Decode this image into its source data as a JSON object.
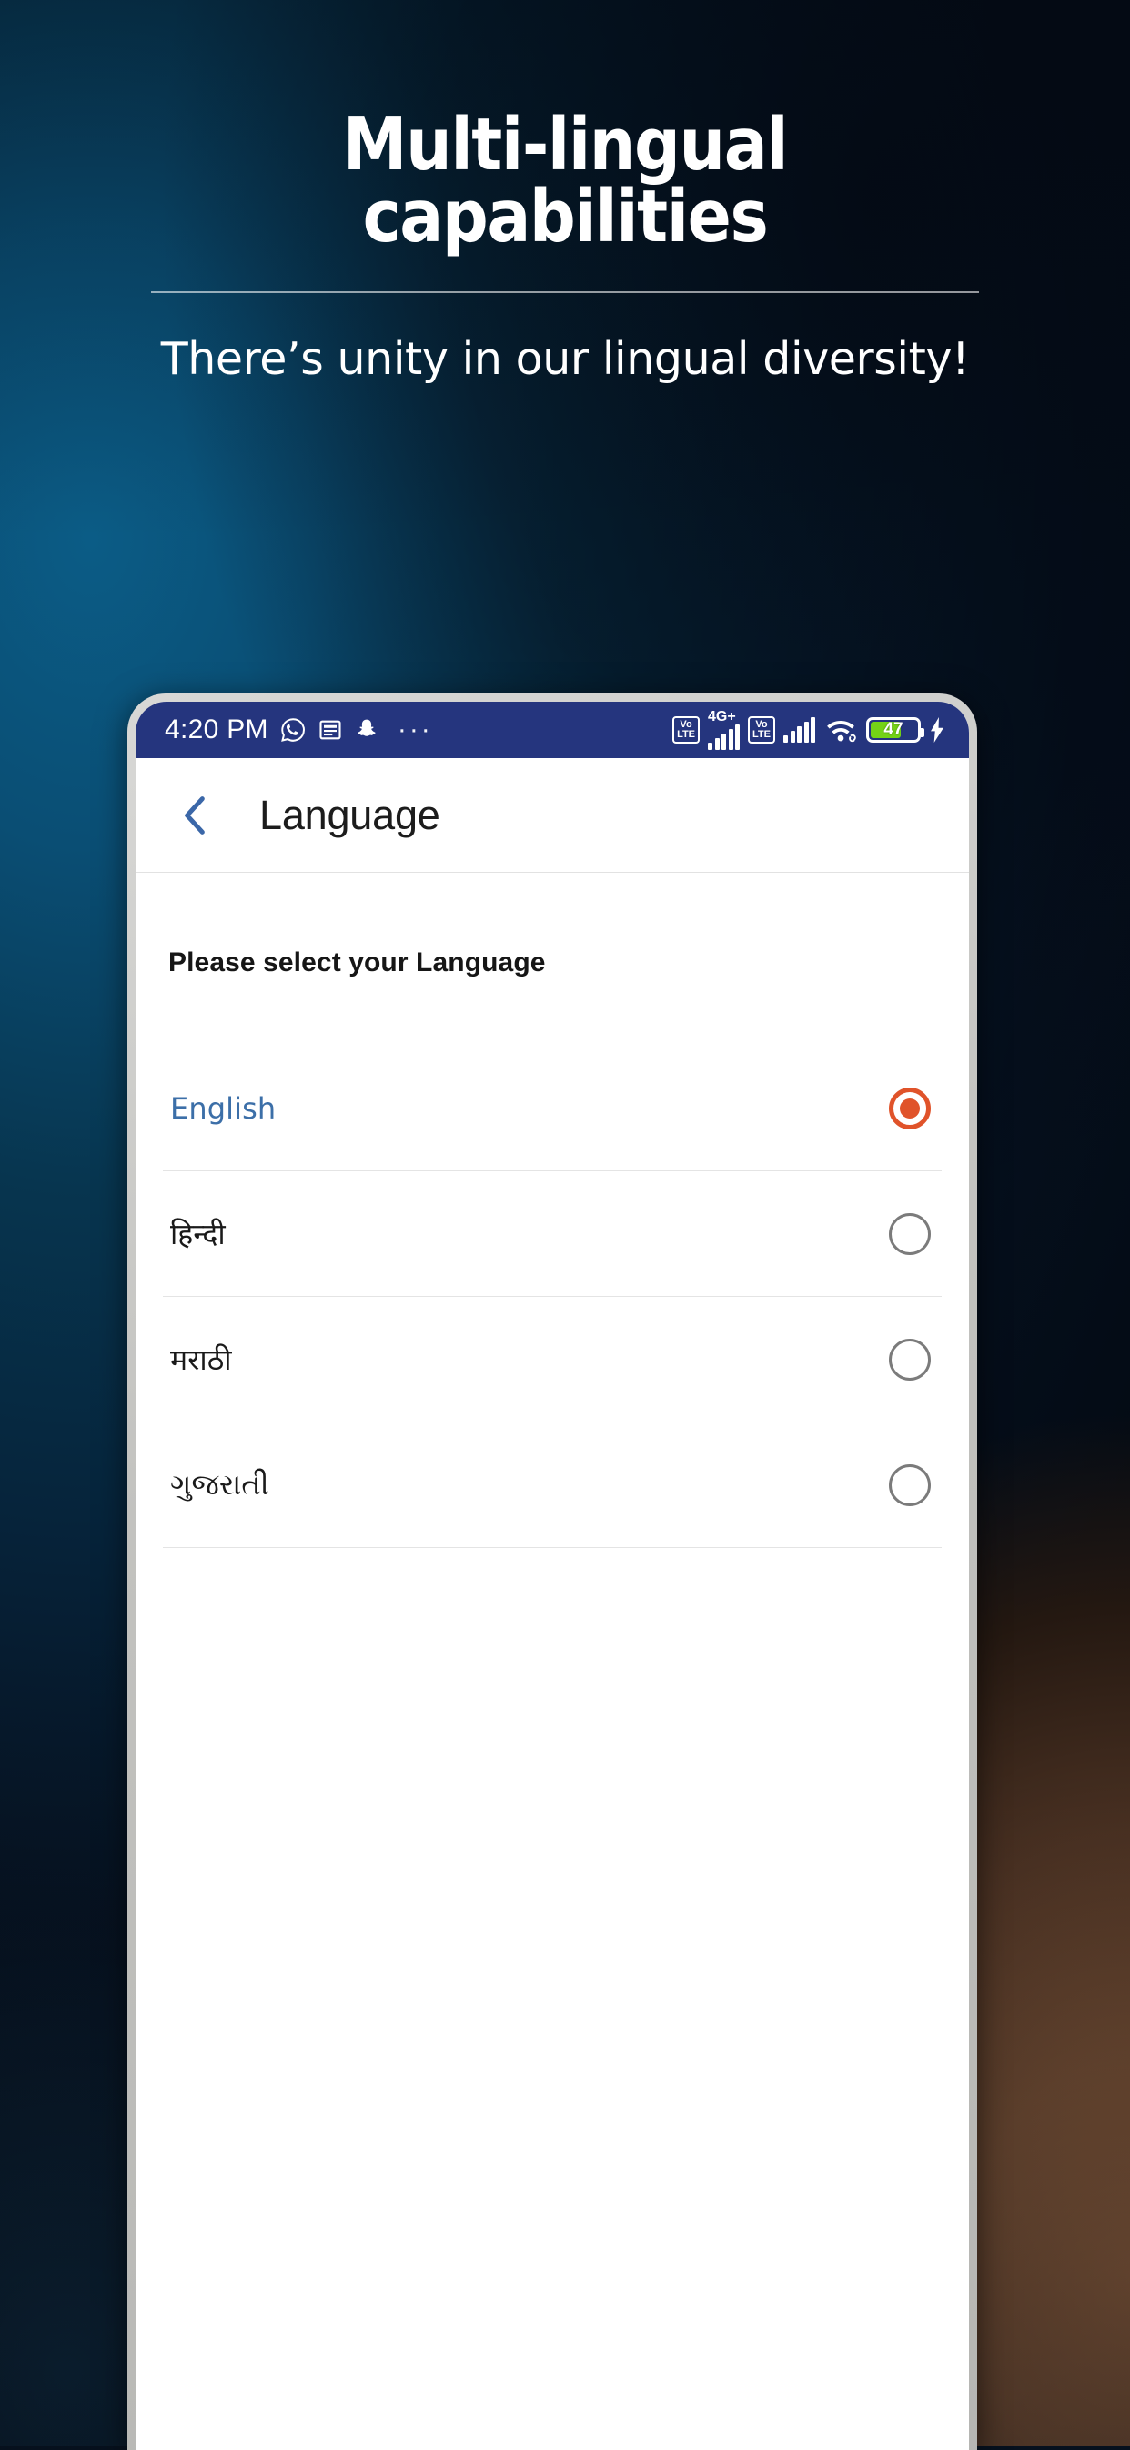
{
  "promo": {
    "title": "Multi-lingual capabilities",
    "title_line1": "Multi-lingual",
    "title_line2": "capabilities",
    "subtitle": "There’s unity in our lingual diversity!"
  },
  "status_bar": {
    "time": "4:20 PM",
    "notification_icons": [
      "whatsapp-icon",
      "news-icon",
      "snapchat-icon"
    ],
    "overflow": "···",
    "sim1_label_top": "Vo",
    "sim1_label_bottom": "LTE",
    "network_type": "4G+",
    "sim2_label_top": "Vo",
    "sim2_label_bottom": "LTE",
    "wifi": "wifi-icon",
    "battery_percent": "47",
    "charging": "charging-bolt-icon",
    "bar_color": "#25357e"
  },
  "app_bar": {
    "back": "chevron-left-icon",
    "title": "Language"
  },
  "screen": {
    "prompt": "Please select your Language",
    "languages": [
      {
        "label": "English",
        "selected": true
      },
      {
        "label": "हिन्दी",
        "selected": false
      },
      {
        "label": "मराठी",
        "selected": false
      },
      {
        "label": "ગુજરાતી",
        "selected": false
      }
    ]
  },
  "colors": {
    "accent_selected": "#e0532a",
    "selected_label": "#3c6fa8",
    "status_bar": "#25357e",
    "back_arrow": "#3b67a8",
    "battery_fill": "#74d316"
  }
}
